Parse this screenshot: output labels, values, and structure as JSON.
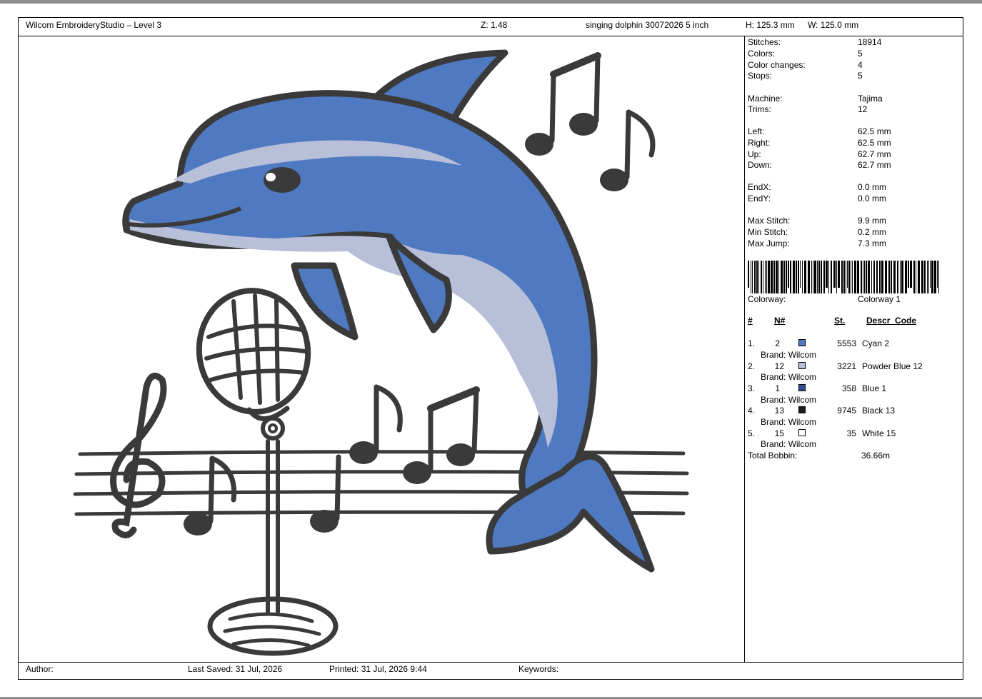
{
  "header": {
    "app_title": "Wilcom EmbroideryStudio – Level 3",
    "zoom": "Z: 1.48",
    "design_name": "singing dolphin 30072026 5 inch",
    "height": "H: 125.3 mm",
    "width": "W: 125.0 mm"
  },
  "footer": {
    "author": "Author:",
    "last_saved": "Last Saved: 31 Jul, 2026",
    "printed": "Printed: 31 Jul, 2026  9:44",
    "keywords": "Keywords:"
  },
  "stats": [
    {
      "label": "Stitches:",
      "value": "18914"
    },
    {
      "label": "Colors:",
      "value": "5"
    },
    {
      "label": "Color changes:",
      "value": "4"
    },
    {
      "label": "Stops:",
      "value": "5"
    },
    {
      "label": "Machine:",
      "value": "Tajima"
    },
    {
      "label": "Trims:",
      "value": "12"
    },
    {
      "label": "Left:",
      "value": "62.5 mm"
    },
    {
      "label": "Right:",
      "value": "62.5 mm"
    },
    {
      "label": "Up:",
      "value": "62.7 mm"
    },
    {
      "label": "Down:",
      "value": "62.7 mm"
    },
    {
      "label": "EndX:",
      "value": "0.0 mm"
    },
    {
      "label": "EndY:",
      "value": "0.0 mm"
    },
    {
      "label": "Max Stitch:",
      "value": "9.9 mm"
    },
    {
      "label": "Min Stitch:",
      "value": "0.2 mm"
    },
    {
      "label": "Max Jump:",
      "value": "7.3 mm"
    }
  ],
  "colorway": {
    "label": "Colorway:",
    "value": "Colorway 1"
  },
  "table": {
    "headers": {
      "index": "#",
      "needle": "N#",
      "stitches": "St.",
      "descr": "Descr_Code"
    },
    "rows": [
      {
        "index": "1.",
        "needle": "2",
        "color": "#4f79c0",
        "stitches": "5553",
        "descr": "Cyan 2",
        "brand": "Brand: Wilcom"
      },
      {
        "index": "2.",
        "needle": "12",
        "color": "#b8bfd8",
        "stitches": "3221",
        "descr": "Powder Blue 12",
        "brand": "Brand: Wilcom"
      },
      {
        "index": "3.",
        "needle": "1",
        "color": "#2e4f8f",
        "stitches": "358",
        "descr": "Blue 1",
        "brand": "Brand: Wilcom"
      },
      {
        "index": "4.",
        "needle": "13",
        "color": "#1d1d1d",
        "stitches": "9745",
        "descr": "Black 13",
        "brand": "Brand: Wilcom"
      },
      {
        "index": "5.",
        "needle": "15",
        "color": "#ffffff",
        "stitches": "35",
        "descr": "White 15",
        "brand": "Brand: Wilcom"
      }
    ],
    "total_label": "Total Bobbin:",
    "total_value": "36.66m"
  },
  "colors": {
    "outline": "#3a3a3a",
    "dolphin_blue": "#4f79c0",
    "powder_blue": "#b8bfd8",
    "deep_blue": "#2e4f8f"
  }
}
